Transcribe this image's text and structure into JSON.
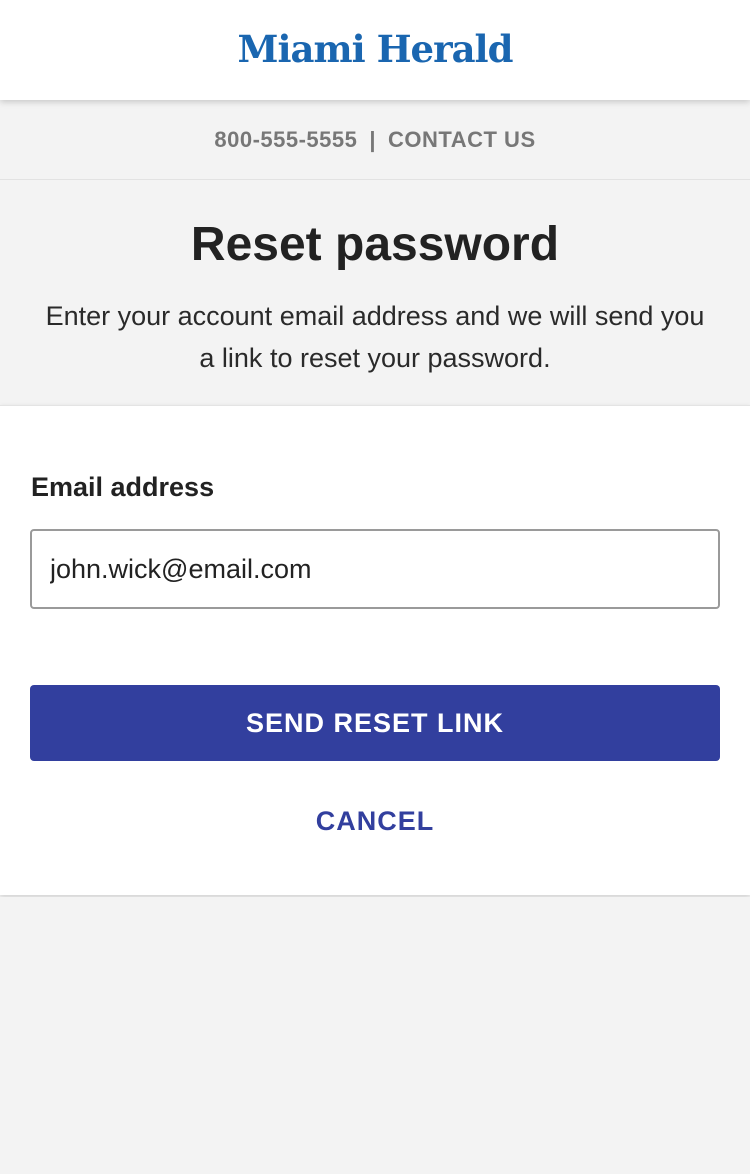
{
  "header": {
    "logo_text": "Miami Herald",
    "logo_color": "#1a66b0"
  },
  "contact_bar": {
    "phone": "800-555-5555",
    "separator": "|",
    "contact_label": "CONTACT US"
  },
  "intro": {
    "title": "Reset password",
    "description": "Enter your account email address and we will send you a link to reset your password."
  },
  "form": {
    "email_label": "Email address",
    "email_value": "john.wick@email.com",
    "submit_label": "SEND RESET LINK",
    "cancel_label": "CANCEL",
    "accent_color": "#323f9e"
  }
}
